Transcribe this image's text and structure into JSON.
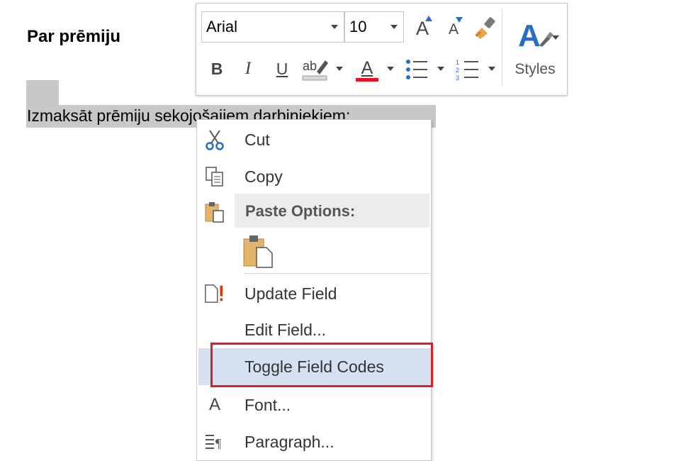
{
  "document": {
    "heading": "Par prēmiju",
    "selected_text": "Izmaksāt prēmiju sekojošajiem darbiniekiem:"
  },
  "mini_toolbar": {
    "font_name": "Arial",
    "font_size": "10",
    "grow_font_glyph": "A",
    "shrink_font_glyph": "A",
    "bold_glyph": "B",
    "italic_glyph": "I",
    "underline_glyph": "U",
    "font_color_glyph": "A",
    "styles_label": "Styles",
    "styles_glyph": "A",
    "font_color_hex": "#e81123",
    "styles_color_hex": "#2b6cc4"
  },
  "context_menu": {
    "items": [
      {
        "label": "Cut",
        "icon": "scissors-icon"
      },
      {
        "label": "Copy",
        "icon": "copy-icon"
      },
      {
        "label": "Paste Options:",
        "icon": "paste-icon"
      },
      {
        "label": "",
        "icon": "keep-text-only-paste-icon"
      },
      {
        "label": "Update Field",
        "icon": "update-field-icon"
      },
      {
        "label": "Edit Field...",
        "icon": ""
      },
      {
        "label": "Toggle Field Codes",
        "icon": ""
      },
      {
        "label": "Font...",
        "icon": "font-icon",
        "glyph": "A"
      },
      {
        "label": "Paragraph...",
        "icon": "paragraph-icon"
      }
    ],
    "highlighted_item": "Toggle Field Codes",
    "highlight_color_hex": "#e01b24"
  }
}
